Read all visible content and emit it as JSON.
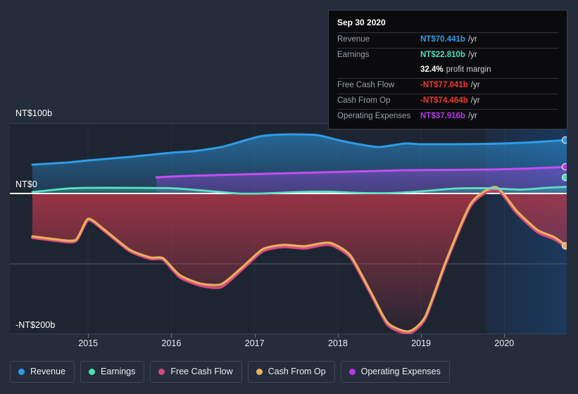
{
  "background_color": "#252d3d",
  "tooltip": {
    "date": "Sep 30 2020",
    "rows": [
      {
        "key": "Revenue",
        "value": "NT$70.441b",
        "suffix": "/yr",
        "color": "#2e9ce8"
      },
      {
        "key": "Earnings",
        "value": "NT$22.810b",
        "suffix": "/yr",
        "color": "#4ae0b6"
      },
      {
        "key": "",
        "value": "32.4%",
        "suffix": "profit margin",
        "color": "#ffffff"
      },
      {
        "key": "Free Cash Flow",
        "value": "-NT$77.041b",
        "suffix": "/yr",
        "color": "#f1382e"
      },
      {
        "key": "Cash From Op",
        "value": "-NT$74.464b",
        "suffix": "/yr",
        "color": "#f1382e"
      },
      {
        "key": "Operating Expenses",
        "value": "NT$37.916b",
        "suffix": "/yr",
        "color": "#b838e8"
      }
    ]
  },
  "legend": {
    "items": [
      {
        "label": "Revenue",
        "color": "#2e9ce8"
      },
      {
        "label": "Earnings",
        "color": "#4ae0b6"
      },
      {
        "label": "Free Cash Flow",
        "color": "#d8487f"
      },
      {
        "label": "Cash From Op",
        "color": "#e8b05c"
      },
      {
        "label": "Operating Expenses",
        "color": "#b838e8"
      }
    ]
  },
  "chart_data": {
    "type": "area",
    "title": "",
    "xlabel": "",
    "ylabel": "",
    "currency": "NT$",
    "units": "b",
    "grid": true,
    "legend_position": "bottom",
    "ylim": [
      -200,
      100
    ],
    "ytick_labels": [
      "NT$100b",
      "NT$0",
      "-NT$200b"
    ],
    "ytick_values": [
      100,
      0,
      -200
    ],
    "gridline_values": [
      100,
      -100,
      -200
    ],
    "zero_line_value": 0,
    "xlim": [
      2014.33,
      2020.75
    ],
    "xtick_labels": [
      "2015",
      "2016",
      "2017",
      "2018",
      "2019",
      "2020"
    ],
    "xtick_values": [
      2015,
      2016,
      2017,
      2018,
      2019,
      2020
    ],
    "highlight_region": {
      "from": 2019.78,
      "to": 2020.75,
      "label": ""
    },
    "series": [
      {
        "name": "Revenue",
        "color": "#2e9ce8",
        "fill": "#1d5c85",
        "x": [
          2014.33,
          2014.75,
          2015.0,
          2015.5,
          2016.0,
          2016.25,
          2016.6,
          2016.9,
          2017.1,
          2017.4,
          2017.75,
          2018.0,
          2018.25,
          2018.5,
          2018.8,
          2019.0,
          2019.4,
          2019.8,
          2020.2,
          2020.5,
          2020.75
        ],
        "y": [
          41.0,
          44.0,
          47.0,
          52.0,
          58.0,
          60.0,
          66.0,
          76.0,
          82.0,
          84.0,
          83.0,
          76.0,
          70.0,
          66.0,
          71.0,
          70.0,
          70.0,
          70.5,
          72.0,
          74.0,
          76.0
        ]
      },
      {
        "name": "Earnings",
        "color": "#5fe0c4",
        "fill": "#1f6d75",
        "x": [
          2014.33,
          2014.75,
          2015.0,
          2015.5,
          2016.0,
          2016.4,
          2016.8,
          2017.1,
          2017.5,
          2017.9,
          2018.2,
          2018.6,
          2019.0,
          2019.4,
          2019.8,
          2020.2,
          2020.5,
          2020.75
        ],
        "y": [
          2.0,
          7.0,
          8.0,
          8.0,
          7.5,
          4.0,
          0.0,
          0.0,
          2.0,
          2.5,
          1.0,
          0.5,
          3.0,
          7.0,
          7.5,
          5.5,
          8.0,
          9.5
        ]
      },
      {
        "name": "Operating Expenses",
        "color": "#c34ef0",
        "fill": "#4b3580",
        "x": [
          2015.82,
          2016.2,
          2016.8,
          2017.3,
          2017.8,
          2018.3,
          2018.8,
          2019.3,
          2019.8,
          2020.3,
          2020.75
        ],
        "y": [
          23.0,
          25.0,
          27.0,
          28.5,
          30.0,
          31.5,
          33.0,
          33.5,
          34.0,
          35.5,
          37.9
        ]
      },
      {
        "name": "Cash From Op",
        "color": "#e8b05c",
        "fill": "#7a2f3d",
        "x": [
          2014.33,
          2014.6,
          2014.85,
          2015.0,
          2015.2,
          2015.5,
          2015.75,
          2015.9,
          2016.1,
          2016.35,
          2016.6,
          2016.85,
          2017.1,
          2017.35,
          2017.6,
          2017.9,
          2018.15,
          2018.4,
          2018.6,
          2018.85,
          2019.05,
          2019.3,
          2019.6,
          2019.9,
          2020.15,
          2020.4,
          2020.6,
          2020.75
        ],
        "y": [
          -61.0,
          -65.0,
          -66.0,
          -36.0,
          -52.0,
          -80.0,
          -91.0,
          -92.0,
          -116.0,
          -128.0,
          -129.0,
          -105.0,
          -79.0,
          -73.0,
          -75.0,
          -70.0,
          -88.0,
          -141.0,
          -184.0,
          -196.0,
          -175.0,
          -96.0,
          -14.0,
          9.0,
          -25.0,
          -52.0,
          -62.0,
          -74.5
        ]
      },
      {
        "name": "Free Cash Flow",
        "color": "#d8487f",
        "fill": "none",
        "x": [
          2014.33,
          2014.6,
          2014.85,
          2015.0,
          2015.2,
          2015.5,
          2015.75,
          2015.9,
          2016.1,
          2016.35,
          2016.6,
          2016.85,
          2017.1,
          2017.35,
          2017.6,
          2017.9,
          2018.15,
          2018.4,
          2018.6,
          2018.85,
          2019.05,
          2019.3,
          2019.6,
          2019.9,
          2020.15,
          2020.4,
          2020.6,
          2020.75
        ],
        "y": [
          -63.0,
          -67.0,
          -68.0,
          -38.0,
          -54.0,
          -82.0,
          -93.0,
          -94.0,
          -119.0,
          -131.0,
          -133.0,
          -108.0,
          -82.0,
          -76.0,
          -78.0,
          -73.0,
          -91.0,
          -144.0,
          -187.0,
          -199.0,
          -178.0,
          -99.0,
          -17.0,
          6.0,
          -28.0,
          -55.0,
          -65.0,
          -77.0
        ]
      }
    ],
    "endpoint_markers": [
      {
        "series": "Revenue",
        "value": 76.0,
        "color": "#2e9ce8"
      },
      {
        "series": "Operating Expenses",
        "value": 37.9,
        "color": "#b838e8"
      },
      {
        "series": "Earnings",
        "value": 22.8,
        "color": "#4ae0b6"
      },
      {
        "series": "Cash From Op",
        "value": -74.5,
        "color": "#e8b05c"
      }
    ]
  }
}
